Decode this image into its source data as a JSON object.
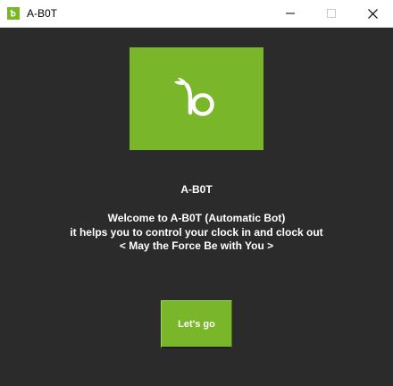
{
  "window": {
    "title": "A-B0T"
  },
  "colors": {
    "accent": "#7ab62a",
    "background": "#2b2b2b",
    "text": "#ffffff"
  },
  "icons": {
    "app_icon": "bamboohr-logo-icon",
    "minimize": "minimize-icon",
    "maximize": "maximize-icon",
    "close": "close-icon",
    "hero_logo": "bamboohr-logo-icon"
  },
  "main": {
    "app_name": "A-B0T",
    "lines": [
      "Welcome to A-B0T (Automatic Bot)",
      "it helps you to control your clock in and clock out",
      "< May the Force Be with You >"
    ],
    "go_button_label": "Let's go"
  }
}
